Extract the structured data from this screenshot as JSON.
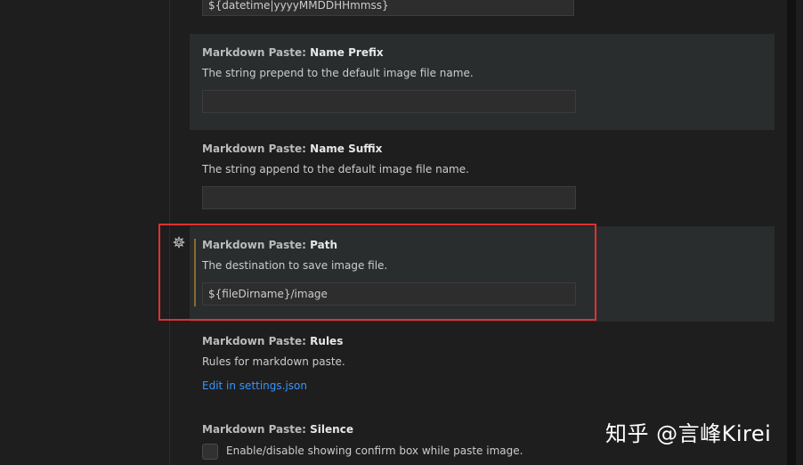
{
  "top_setting": {
    "value": "${datetime|yyyyMMDDHHmmss}"
  },
  "settings": [
    {
      "category": "Markdown Paste: ",
      "key": "Name Prefix",
      "description": "The string prepend to the default image file name.",
      "value": ""
    },
    {
      "category": "Markdown Paste: ",
      "key": "Name Suffix",
      "description": "The string append to the default image file name.",
      "value": ""
    },
    {
      "category": "Markdown Paste: ",
      "key": "Path",
      "description": "The destination to save image file.",
      "value": "${fileDirname}/image",
      "modified": true,
      "icon": "gear-icon"
    },
    {
      "category": "Markdown Paste: ",
      "key": "Rules",
      "description": "Rules for markdown paste.",
      "link": "Edit in settings.json"
    },
    {
      "category": "Markdown Paste: ",
      "key": "Silence",
      "checkbox_label": "Enable/disable showing confirm box while paste image.",
      "checked": false
    }
  ],
  "watermark": "知乎 @言峰Kirei",
  "colors": {
    "background": "#1e1e1e",
    "highlight_row": "#2a2d2e",
    "link": "#3794ff",
    "modified_indicator": "#876b30",
    "annotation_box": "#e03131"
  }
}
